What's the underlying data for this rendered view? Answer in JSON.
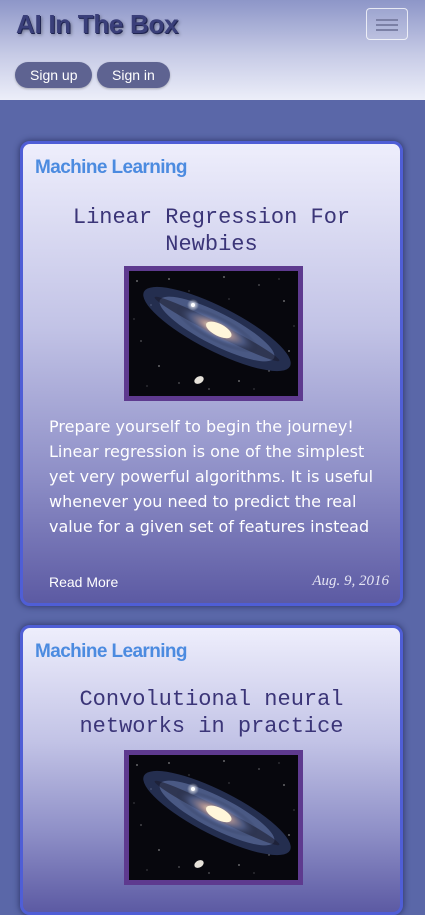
{
  "header": {
    "brand": "AI In The Box",
    "menu_toggle_icon": "hamburger-menu-icon",
    "signup_label": "Sign up",
    "signin_label": "Sign in"
  },
  "posts": [
    {
      "category": "Machine Learning",
      "title": "Linear Regression For Newbies",
      "image": "galaxy-image",
      "excerpt": "Prepare yourself to begin the journey! Linear regression is one of the simplest yet very powerful algorithms. It is useful whenever you need to predict the real value for a given set of features instead of trying to guess",
      "read_more": "Read More",
      "date": "Aug. 9, 2016"
    },
    {
      "category": "Machine Learning",
      "title": "Convolutional neural networks in practice",
      "image": "galaxy-image"
    }
  ],
  "colors": {
    "page_background": "#5a67a8",
    "category": "#4c8be0",
    "card_border": "#4f5ed6",
    "image_frame": "#5e3a8f"
  }
}
